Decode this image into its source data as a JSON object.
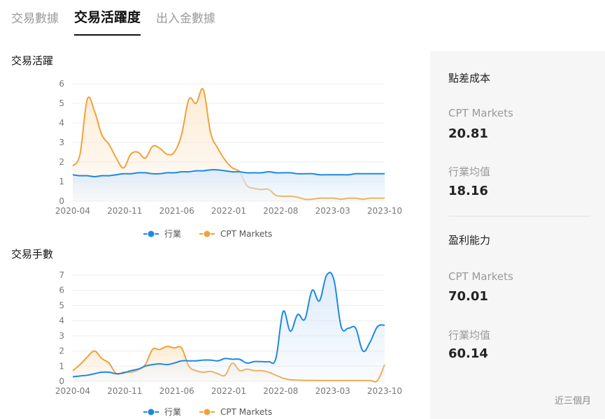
{
  "tabs": [
    "交易數據",
    "交易活躍度",
    "出入金數據"
  ],
  "active_tab": 1,
  "colors": {
    "industry": "#1e88e5",
    "cpt": "#f0a23c",
    "industry_fill": "#dcebfb",
    "cpt_fill": "#fdebd3"
  },
  "chart_data": [
    {
      "type": "line",
      "title": "交易活躍",
      "xticks": [
        "2020-04",
        "2020-11",
        "2021-06",
        "2022-01",
        "2022-08",
        "2023-03",
        "2023-10"
      ],
      "ylim": [
        0,
        6
      ],
      "yticks": [
        0,
        1,
        2,
        3,
        4,
        5,
        6
      ],
      "grid": true,
      "legend": "bottom-center",
      "x": [
        "2020-04",
        "2020-05",
        "2020-06",
        "2020-07",
        "2020-08",
        "2020-09",
        "2020-10",
        "2020-11",
        "2020-12",
        "2021-01",
        "2021-02",
        "2021-03",
        "2021-04",
        "2021-05",
        "2021-06",
        "2021-07",
        "2021-08",
        "2021-09",
        "2021-10",
        "2021-11",
        "2021-12",
        "2022-01",
        "2022-02",
        "2022-03",
        "2022-04",
        "2022-05",
        "2022-06",
        "2022-07",
        "2022-08",
        "2022-09",
        "2022-10",
        "2022-11",
        "2022-12",
        "2023-01",
        "2023-02",
        "2023-03",
        "2023-04",
        "2023-05",
        "2023-06",
        "2023-07",
        "2023-08",
        "2023-09",
        "2023-10",
        "2023-11"
      ],
      "series": [
        {
          "name": "行業",
          "values": [
            1.35,
            1.3,
            1.3,
            1.25,
            1.3,
            1.3,
            1.35,
            1.4,
            1.4,
            1.45,
            1.45,
            1.4,
            1.4,
            1.45,
            1.45,
            1.5,
            1.5,
            1.55,
            1.55,
            1.6,
            1.6,
            1.55,
            1.5,
            1.5,
            1.45,
            1.45,
            1.45,
            1.5,
            1.45,
            1.45,
            1.45,
            1.4,
            1.4,
            1.4,
            1.35,
            1.35,
            1.35,
            1.35,
            1.35,
            1.4,
            1.4,
            1.4,
            1.4,
            1.4
          ]
        },
        {
          "name": "CPT Markets",
          "values": [
            1.8,
            2.4,
            5.2,
            4.6,
            3.4,
            2.9,
            2.2,
            1.7,
            2.4,
            2.5,
            2.2,
            2.8,
            2.7,
            2.4,
            2.5,
            3.4,
            5.2,
            5.0,
            5.7,
            3.5,
            2.7,
            2.1,
            1.7,
            1.5,
            0.8,
            0.65,
            0.6,
            0.6,
            0.3,
            0.25,
            0.25,
            0.2,
            0.1,
            0.1,
            0.15,
            0.15,
            0.15,
            0.1,
            0.15,
            0.15,
            0.1,
            0.15,
            0.15,
            0.15
          ]
        }
      ]
    },
    {
      "type": "line",
      "title": "交易手數",
      "xticks": [
        "2020-04",
        "2020-11",
        "2021-06",
        "2022-01",
        "2022-08",
        "2023-03",
        "2023-10"
      ],
      "ylim": [
        0,
        7
      ],
      "yticks": [
        0,
        1,
        2,
        3,
        4,
        5,
        6,
        7
      ],
      "grid": true,
      "legend": "bottom-center",
      "x": [
        "2020-04",
        "2020-05",
        "2020-06",
        "2020-07",
        "2020-08",
        "2020-09",
        "2020-10",
        "2020-11",
        "2020-12",
        "2021-01",
        "2021-02",
        "2021-03",
        "2021-04",
        "2021-05",
        "2021-06",
        "2021-07",
        "2021-08",
        "2021-09",
        "2021-10",
        "2021-11",
        "2021-12",
        "2022-01",
        "2022-02",
        "2022-03",
        "2022-04",
        "2022-05",
        "2022-06",
        "2022-07",
        "2022-08",
        "2022-09",
        "2022-10",
        "2022-11",
        "2022-12",
        "2023-01",
        "2023-02",
        "2023-03",
        "2023-04",
        "2023-05",
        "2023-06",
        "2023-07",
        "2023-08",
        "2023-09",
        "2023-10",
        "2023-11"
      ],
      "series": [
        {
          "name": "行業",
          "values": [
            0.3,
            0.35,
            0.4,
            0.5,
            0.6,
            0.6,
            0.5,
            0.55,
            0.7,
            0.8,
            1.0,
            1.1,
            1.15,
            1.1,
            1.2,
            1.35,
            1.35,
            1.35,
            1.4,
            1.4,
            1.35,
            1.5,
            1.45,
            1.45,
            1.2,
            1.3,
            1.3,
            1.3,
            1.5,
            4.6,
            3.3,
            4.4,
            4.1,
            6.0,
            5.3,
            7.0,
            6.7,
            3.6,
            3.5,
            3.5,
            2.0,
            2.6,
            3.6,
            3.7
          ]
        },
        {
          "name": "CPT Markets",
          "values": [
            0.7,
            1.1,
            1.6,
            2.0,
            1.5,
            1.2,
            0.5,
            0.6,
            0.6,
            0.75,
            1.1,
            2.1,
            2.1,
            2.3,
            2.2,
            2.2,
            1.0,
            0.7,
            0.6,
            0.65,
            0.5,
            0.4,
            1.2,
            0.7,
            0.8,
            0.7,
            0.7,
            0.6,
            0.4,
            0.2,
            0.1,
            0.08,
            0.06,
            0.06,
            0.05,
            0.05,
            0.05,
            0.05,
            0.05,
            0.05,
            0.05,
            0.05,
            0.05,
            1.1
          ]
        }
      ]
    }
  ],
  "panel": {
    "sections": [
      {
        "title": "點差成本",
        "items": [
          {
            "label": "CPT Markets",
            "value": "20.81"
          },
          {
            "label": "行業均值",
            "value": "18.16"
          }
        ]
      },
      {
        "title": "盈利能力",
        "items": [
          {
            "label": "CPT Markets",
            "value": "70.01"
          },
          {
            "label": "行業均值",
            "value": "60.14"
          }
        ]
      }
    ],
    "footnote": "近三個月"
  }
}
